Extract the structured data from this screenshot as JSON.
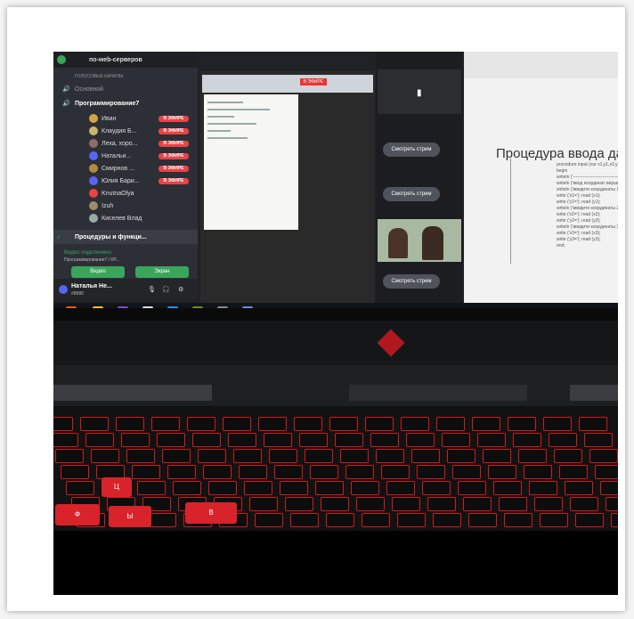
{
  "discord": {
    "server": "по-web-серверов",
    "voice_header": "ГОЛОСОВЫЕ КАНАЛЫ",
    "channel_main": "Основной",
    "channel_prog": "Программирование7",
    "live": "В ЭФИРЕ",
    "members": [
      {
        "name": "Иван",
        "live": true,
        "color": "#d4a24c"
      },
      {
        "name": "Клаудия Б...",
        "live": true,
        "color": "#c9b46a"
      },
      {
        "name": "Леха, хоро...",
        "live": true,
        "color": "#8d6e63"
      },
      {
        "name": "Натальи...",
        "live": true,
        "color": "#5865f2"
      },
      {
        "name": "Смирнов ...",
        "live": true,
        "color": "#b58a3c"
      },
      {
        "name": "Юлия Бари...",
        "live": true,
        "color": "#5865f2"
      },
      {
        "name": "KnutnaOlya",
        "live": false,
        "color": "#ed4245"
      },
      {
        "name": "Izuh",
        "live": false,
        "color": "#a08a6a"
      },
      {
        "name": "Киселев Влад",
        "live": false,
        "color": "#9aa"
      }
    ],
    "channel_procedures": "Процедуры и функци...",
    "video_connected": "Видео подключено",
    "video_sub": "Программирование7 / КР...",
    "video_button": "Видео",
    "screen_button": "Экран",
    "user_name": "Наталья Не...",
    "user_tag": "#8980"
  },
  "streams": {
    "watch_label": "Смотреть стрим"
  },
  "slide": {
    "title": "Процедура ввода да",
    "code": [
      "procedure input (var x1,y1,x2,y2,x",
      "begin",
      "writeln ('--------------------------------');",
      "writeln ('ввод координат вершин т",
      "  writeln ('введите координаты 1 в",
      "write ('x1=');       read (x1);",
      "write ('y1=');       read (y1);",
      "  writeln ('введите координаты 2 в",
      "write ('x2=');       read (x2);",
      "write ('y2=');       read (y2);",
      "  writeln ('введите координаты 3 в",
      "write ('x3=');       read (x3);",
      "write ('y3=');       read (y3);",
      "end;"
    ]
  },
  "keyboard": {
    "keys_visible": [
      "Ц",
      "Ф",
      "Ы",
      "В"
    ]
  },
  "colors": {
    "discord_green": "#3ba55c",
    "live_red": "#ed4245",
    "keyboard_red": "#d41a1a"
  }
}
